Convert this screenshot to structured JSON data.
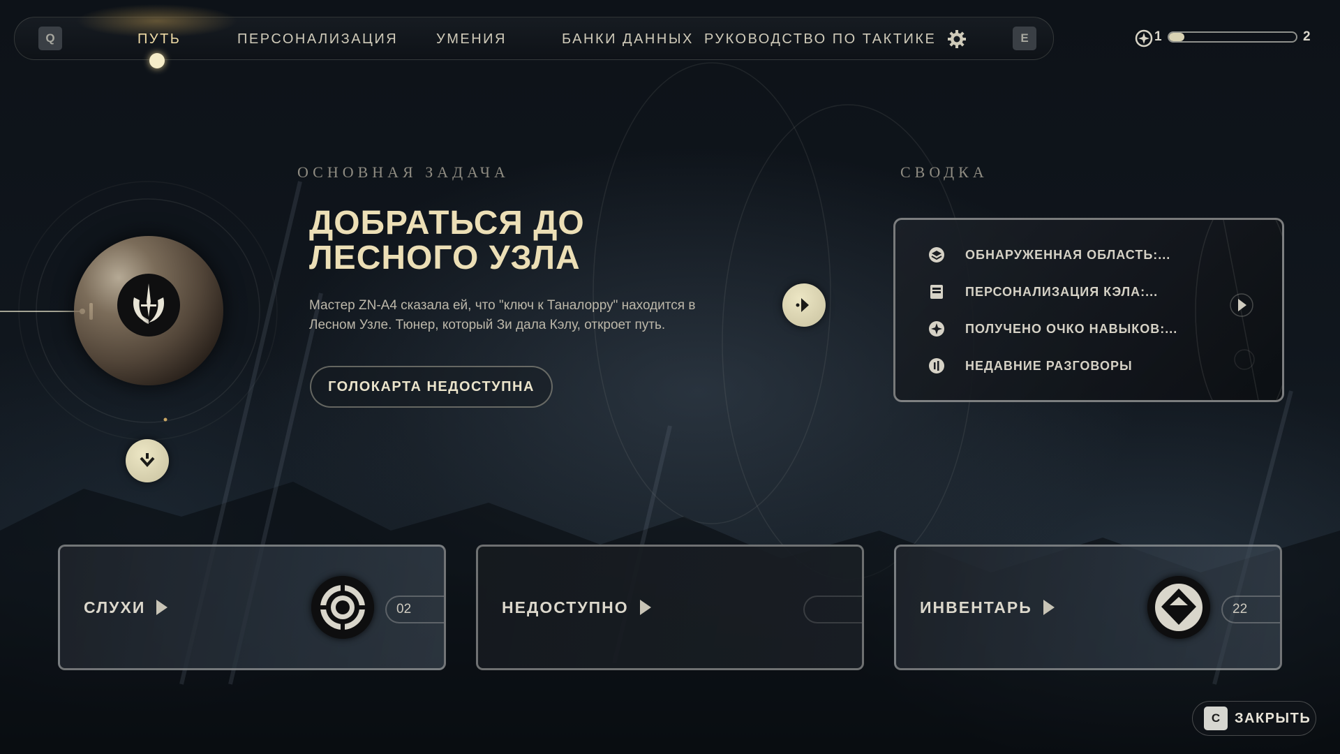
{
  "nav": {
    "left_key": "Q",
    "right_key": "E",
    "tabs": [
      {
        "label": "ПУТЬ",
        "active": true
      },
      {
        "label": "ПЕРСОНАЛИЗАЦИЯ",
        "active": false
      },
      {
        "label": "УМЕНИЯ",
        "active": false
      },
      {
        "label": "БАНКИ ДАННЫХ",
        "active": false
      },
      {
        "label": "РУКОВОДСТВО ПО ТАКТИКЕ",
        "active": false
      }
    ],
    "settings_icon": "gear-icon"
  },
  "xp": {
    "current_level": "1",
    "next_level": "2",
    "progress": 0.12,
    "icon": "skill-point-icon"
  },
  "objective": {
    "section_heading": "ОСНОВНАЯ ЗАДАЧА",
    "title_line1": "ДОБРАТЬСЯ ДО",
    "title_line2": "ЛЕСНОГО УЗЛА",
    "description": "Мастер ZN-A4 сказала ей, что \"ключ к Таналорру\" находится в Лесном Узле. Тюнер, который Зи дала Кэлу, откроет путь.",
    "holomap_button": "ГОЛОКАРТА НЕДОСТУПНА",
    "planet_icon": "jedi-order-icon"
  },
  "summary": {
    "section_heading": "СВОДКА",
    "items": [
      {
        "label": "ОБНАРУЖЕННАЯ ОБЛАСТЬ:...",
        "icon": "area-discovered-icon"
      },
      {
        "label": "ПЕРСОНАЛИЗАЦИЯ КЭЛА:...",
        "icon": "customization-icon"
      },
      {
        "label": "ПОЛУЧЕНО ОЧКО НАВЫКОВ:...",
        "icon": "skill-point-icon"
      },
      {
        "label": "НЕДАВНИЕ РАЗГОВОРЫ",
        "icon": "conversation-icon"
      }
    ]
  },
  "cards": {
    "rumors": {
      "label": "СЛУХИ",
      "count": "02",
      "icon": "rumors-icon"
    },
    "unavailable": {
      "label": "НЕДОСТУПНО"
    },
    "inventory": {
      "label": "ИНВЕНТАРЬ",
      "count": "22",
      "icon": "inventory-icon"
    }
  },
  "close": {
    "key": "C",
    "label": "ЗАКРЫТЬ"
  }
}
